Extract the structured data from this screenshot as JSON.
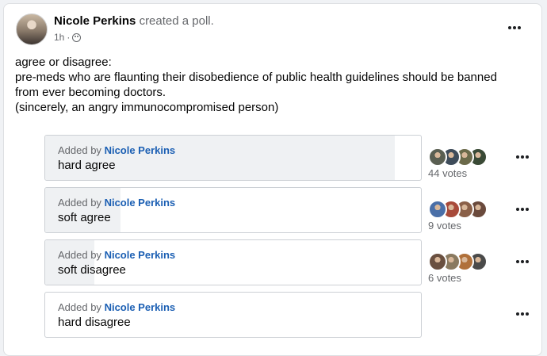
{
  "post": {
    "author": "Nicole Perkins",
    "action": "created a poll.",
    "time": "1h",
    "separator": "·",
    "privacy_icon": "globe-icon",
    "menu_icon": "more-horizontal-icon",
    "text_lines": [
      "agree or disagree:",
      "pre-meds who are flaunting their disobedience of public health guidelines should be banned from ever becoming doctors.",
      "(sincerely, an angry immunocompromised person)"
    ]
  },
  "poll": {
    "added_by_prefix": "Added by",
    "options": [
      {
        "added_by": "Nicole Perkins",
        "label": "hard agree",
        "votes": "44 votes",
        "share": 0.93,
        "voter_count_shown": 4
      },
      {
        "added_by": "Nicole Perkins",
        "label": "soft agree",
        "votes": "9 votes",
        "share": 0.2,
        "voter_count_shown": 4
      },
      {
        "added_by": "Nicole Perkins",
        "label": "soft disagree",
        "votes": "6 votes",
        "share": 0.13,
        "voter_count_shown": 4
      },
      {
        "added_by": "Nicole Perkins",
        "label": "hard disagree",
        "votes": "",
        "share": 0.0,
        "voter_count_shown": 0
      }
    ]
  },
  "colors": {
    "link_blue": "#1b5fb3",
    "fill_grey": "#eff1f3",
    "muted_text": "#65676b"
  }
}
